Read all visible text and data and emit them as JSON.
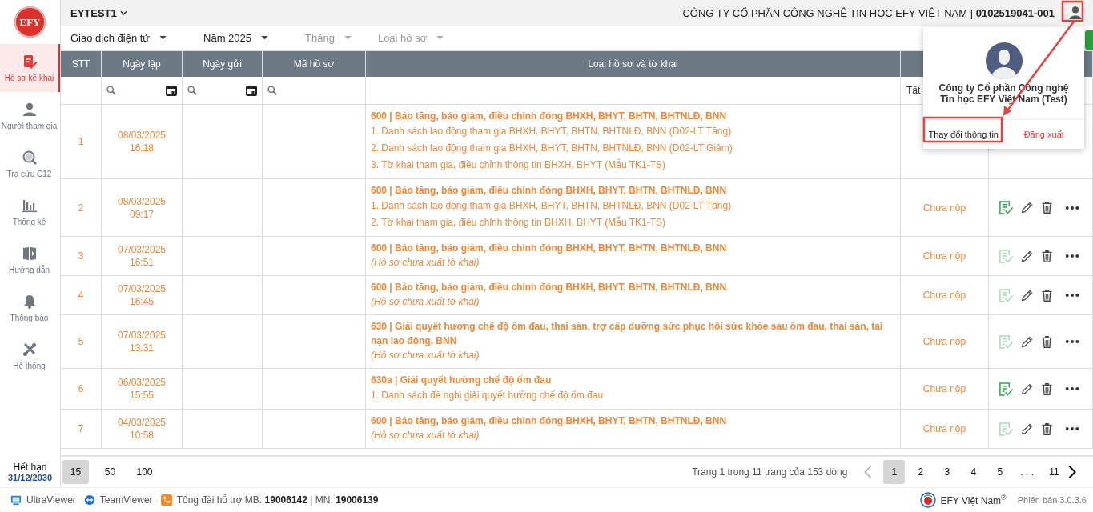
{
  "sidebar": {
    "logo": "EFY",
    "items": [
      {
        "label": "Hồ sơ kê khai",
        "selected": true
      },
      {
        "label": "Người tham gia",
        "selected": false
      },
      {
        "label": "Tra cứu C12",
        "selected": false
      },
      {
        "label": "Thống kê",
        "selected": false
      },
      {
        "label": "Hướng dẫn",
        "selected": false
      },
      {
        "label": "Thông báo",
        "selected": false
      },
      {
        "label": "Hệ thống",
        "selected": false
      }
    ],
    "expiry": {
      "label": "Hết hạn",
      "date": "31/12/2030"
    }
  },
  "topbar": {
    "account": "EYTEST1",
    "company": "CÔNG TY CỔ PHẦN CÔNG NGHỆ TIN HỌC EFY VIỆT NAM | **0102519041-001**"
  },
  "filters": [
    {
      "value": "Giao dịch điện tử"
    },
    {
      "value": "Năm 2025"
    },
    {
      "placeholder": "Tháng"
    },
    {
      "placeholder": "Loại hồ sơ"
    }
  ],
  "table": {
    "columns": [
      "STT",
      "Ngày lập",
      "Ngày gửi",
      "Mã hồ sơ",
      "Loại hồ sơ và tờ khai"
    ],
    "status_filter": "Tất",
    "rows": [
      {
        "stt": "1",
        "date": "08/03/2025",
        "time": "16:18",
        "title": "600 | Báo tăng, báo giảm, điều chỉnh đóng BHXH, BHYT, BHTN, BHTNLĐ, BNN",
        "lines": [
          {
            "kind": "item",
            "text": "1. Danh sách lao động tham gia BHXH, BHYT, BHTN, BHTNLĐ, BNN (D02-LT Tăng)"
          },
          {
            "kind": "item",
            "text": "2. Danh sách lao động tham gia BHXH, BHYT, BHTN, BHTNLĐ, BNN (D02-LT Giảm)"
          },
          {
            "kind": "item",
            "text": "3. Tờ khai tham gia, điều chỉnh thông tin BHXH, BHYT (Mẫu TK1-TS)"
          }
        ]
      },
      {
        "stt": "2",
        "date": "08/03/2025",
        "time": "09:17",
        "title": "600 | Báo tăng, báo giảm, điều chỉnh đóng BHXH, BHYT, BHTN, BHTNLĐ, BNN",
        "lines": [
          {
            "kind": "item",
            "text": "1. Danh sách lao động tham gia BHXH, BHYT, BHTN, BHTNLĐ, BNN (D02-LT Tăng)"
          },
          {
            "kind": "item",
            "text": "2. Tờ khai tham gia, điều chỉnh thông tin BHXH, BHYT (Mẫu TK1-TS)"
          }
        ],
        "status": "Chưa nộp",
        "sign_enabled": true
      },
      {
        "stt": "3",
        "date": "07/03/2025",
        "time": "16:51",
        "title": "600 | Báo tăng, báo giảm, điều chỉnh đóng BHXH, BHYT, BHTN, BHTNLĐ, BNN",
        "lines": [
          {
            "kind": "note",
            "text": "(Hồ sơ chưa xuất tờ khai)"
          }
        ],
        "status": "Chưa nộp",
        "sign_enabled": false
      },
      {
        "stt": "4",
        "date": "07/03/2025",
        "time": "16:45",
        "title": "600 | Báo tăng, báo giảm, điều chỉnh đóng BHXH, BHYT, BHTN, BHTNLĐ, BNN",
        "lines": [
          {
            "kind": "note",
            "text": "(Hồ sơ chưa xuất tờ khai)"
          }
        ],
        "status": "Chưa nộp",
        "sign_enabled": false
      },
      {
        "stt": "5",
        "date": "07/03/2025",
        "time": "13:31",
        "title": "630 | Giải quyết hưởng chế độ ốm đau, thai sản, trợ cấp dưỡng sức phục hồi sức khỏe sau ốm đau, thai sản, tai nạn lao động, BNN",
        "lines": [
          {
            "kind": "note",
            "text": "(Hồ sơ chưa xuất tờ khai)"
          }
        ],
        "status": "Chưa nộp",
        "sign_enabled": false
      },
      {
        "stt": "6",
        "date": "06/03/2025",
        "time": "15:55",
        "title": "630a | Giải quyết hưởng chế độ ốm đau",
        "lines": [
          {
            "kind": "item",
            "text": "1. Danh sách đề nghị giải quyết hưởng chế độ ốm đau"
          }
        ],
        "status": "Chưa nộp",
        "sign_enabled": true
      },
      {
        "stt": "7",
        "date": "04/03/2025",
        "time": "10:58",
        "title": "600 | Báo tăng, báo giảm, điều chỉnh đóng BHXH, BHYT, BHTN, BHTNLĐ, BNN",
        "lines": [
          {
            "kind": "note",
            "text": "(Hồ sơ chưa xuất tờ khai)"
          }
        ],
        "status": "Chưa nộp",
        "sign_enabled": false
      }
    ]
  },
  "pagination": {
    "page_sizes": [
      {
        "label": "15",
        "selected": true
      },
      {
        "label": "50",
        "selected": false
      },
      {
        "label": "100",
        "selected": false
      }
    ],
    "info": "Trang 1 trong 11 trang của 153 dòng",
    "prev_disabled": true,
    "pages": [
      {
        "label": "1",
        "selected": true
      },
      {
        "label": "2",
        "selected": false
      },
      {
        "label": "3",
        "selected": false
      },
      {
        "label": "4",
        "selected": false
      },
      {
        "label": "5",
        "selected": false
      },
      {
        "label": ". . .",
        "selected": false
      },
      {
        "label": "11",
        "selected": false
      }
    ],
    "next_disabled": false
  },
  "footer": {
    "links": [
      "UltraViewer",
      "TeamViewer"
    ],
    "hotline": "Tổng đài hỗ trợ MB: **19006142** | MN: **19006139**",
    "brand": "EFY Việt Nam",
    "brand_mark": "®",
    "version": "Phiên bản 3.0.3.6"
  },
  "user_menu": {
    "name": "Công ty Cổ phần Công nghệ Tin học EFY Việt Nam (Test)",
    "buttons": [
      {
        "label": "Thay đổi thông tin",
        "kind": "normal"
      },
      {
        "label": "Đăng xuất",
        "kind": "danger"
      }
    ]
  }
}
